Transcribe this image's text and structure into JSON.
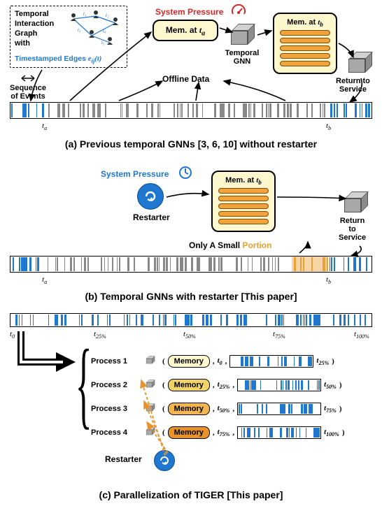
{
  "panel_a": {
    "caption": "(a) Previous temporal GNNs [3, 6, 10] without restarter",
    "dashed": {
      "line1": "Temporal",
      "line2": "Interaction",
      "line3": "Graph",
      "line4": "with",
      "blue": "Timestamped Edges e_{ij}(t)"
    },
    "seq_label1": "Sequence",
    "seq_label2": "of Events",
    "offline": "Offline Data",
    "pressure": "System Pressure",
    "mem_a": "Mem. at t_a",
    "tgnn": "Temporal\nGNN",
    "mem_b": "Mem. at t_b",
    "return": "Return to\nService",
    "barcode": {
      "t_a_pct": 10,
      "t_b_pct": 88,
      "ranges": {
        "left_blue": [
          0,
          10
        ],
        "mid_gray": [
          10,
          88
        ],
        "right_blue": [
          88,
          100
        ]
      }
    },
    "t_a": "t_a",
    "t_b": "t_b"
  },
  "panel_b": {
    "caption": "(b) Temporal GNNs with restarter [This paper]",
    "pressure": "System Pressure",
    "restarter": "Restarter",
    "mem_b": "Mem. at t_b",
    "return": "Return\nto\nService",
    "portion": "Only A Small Portion",
    "barcode": {
      "t_a_pct": 10,
      "t_b_pct": 88,
      "orange_start_pct": 78,
      "orange_end_pct": 88
    },
    "t_a": "t_a",
    "t_b": "t_b"
  },
  "panel_c": {
    "caption": "(c) Parallelization of TIGER [This paper]",
    "ticks": [
      "t_0",
      "t_25%",
      "t_50%",
      "t_75%",
      "t_100%"
    ],
    "processes": [
      {
        "label": "Process 1",
        "mem": "Memory",
        "mem_class": "y",
        "t_start": "t_0",
        "t_end": "t_25%",
        "bar_range": [
          0,
          25
        ]
      },
      {
        "label": "Process 2",
        "mem": "Memory",
        "mem_class": "o1",
        "t_start": "t_25%",
        "t_end": "t_50%",
        "bar_range": [
          25,
          50
        ]
      },
      {
        "label": "Process 3",
        "mem": "Memory",
        "mem_class": "o2",
        "t_start": "t_50%",
        "t_end": "t_75%",
        "bar_range": [
          50,
          75
        ]
      },
      {
        "label": "Process 4",
        "mem": "Memory",
        "mem_class": "o3",
        "t_start": "t_75%",
        "t_end": "t_100%",
        "bar_range": [
          75,
          100
        ]
      }
    ],
    "restarter": "Restarter",
    "brace_left": "{"
  },
  "icons": {
    "gauge": "gauge-icon",
    "clock": "clock-icon",
    "reload": "reload-icon",
    "person": "person-icon",
    "edge_label_1": "t_1",
    "edge_label_2": "t_2",
    "edge_label_3": "t_3",
    "edge_label_4": "t_4",
    "edge_label_5": "t_5"
  },
  "colors": {
    "blue": "#1F77D0",
    "gray": "#888888",
    "orange": "#E8A239",
    "red": "#D62728",
    "yellow": "#FFF8CF"
  },
  "chart_data": [
    {
      "type": "timeline",
      "panel": "a",
      "axis": {
        "start": "t_a",
        "end": "t_b",
        "start_pct": 10,
        "end_pct": 88
      },
      "segments": [
        {
          "range_pct": [
            0,
            10
          ],
          "state": "online",
          "color": "blue"
        },
        {
          "range_pct": [
            10,
            88
          ],
          "state": "offline_catchup",
          "color": "gray"
        },
        {
          "range_pct": [
            88,
            100
          ],
          "state": "online",
          "color": "blue"
        }
      ]
    },
    {
      "type": "timeline",
      "panel": "b",
      "axis": {
        "start": "t_a",
        "end": "t_b",
        "start_pct": 10,
        "end_pct": 88
      },
      "segments": [
        {
          "range_pct": [
            0,
            10
          ],
          "state": "online",
          "color": "blue"
        },
        {
          "range_pct": [
            10,
            78
          ],
          "state": "skipped",
          "color": "gray"
        },
        {
          "range_pct": [
            78,
            88
          ],
          "state": "restart_portion",
          "color": "orange"
        },
        {
          "range_pct": [
            88,
            100
          ],
          "state": "online",
          "color": "blue"
        }
      ]
    },
    {
      "type": "parallel-timeline",
      "panel": "c",
      "full_axis_ticks_pct": [
        0,
        25,
        50,
        75,
        100
      ],
      "processes": [
        {
          "name": "Process 1",
          "range_pct": [
            0,
            25
          ]
        },
        {
          "name": "Process 2",
          "range_pct": [
            25,
            50
          ]
        },
        {
          "name": "Process 3",
          "range_pct": [
            50,
            75
          ]
        },
        {
          "name": "Process 4",
          "range_pct": [
            75,
            100
          ]
        }
      ]
    }
  ]
}
